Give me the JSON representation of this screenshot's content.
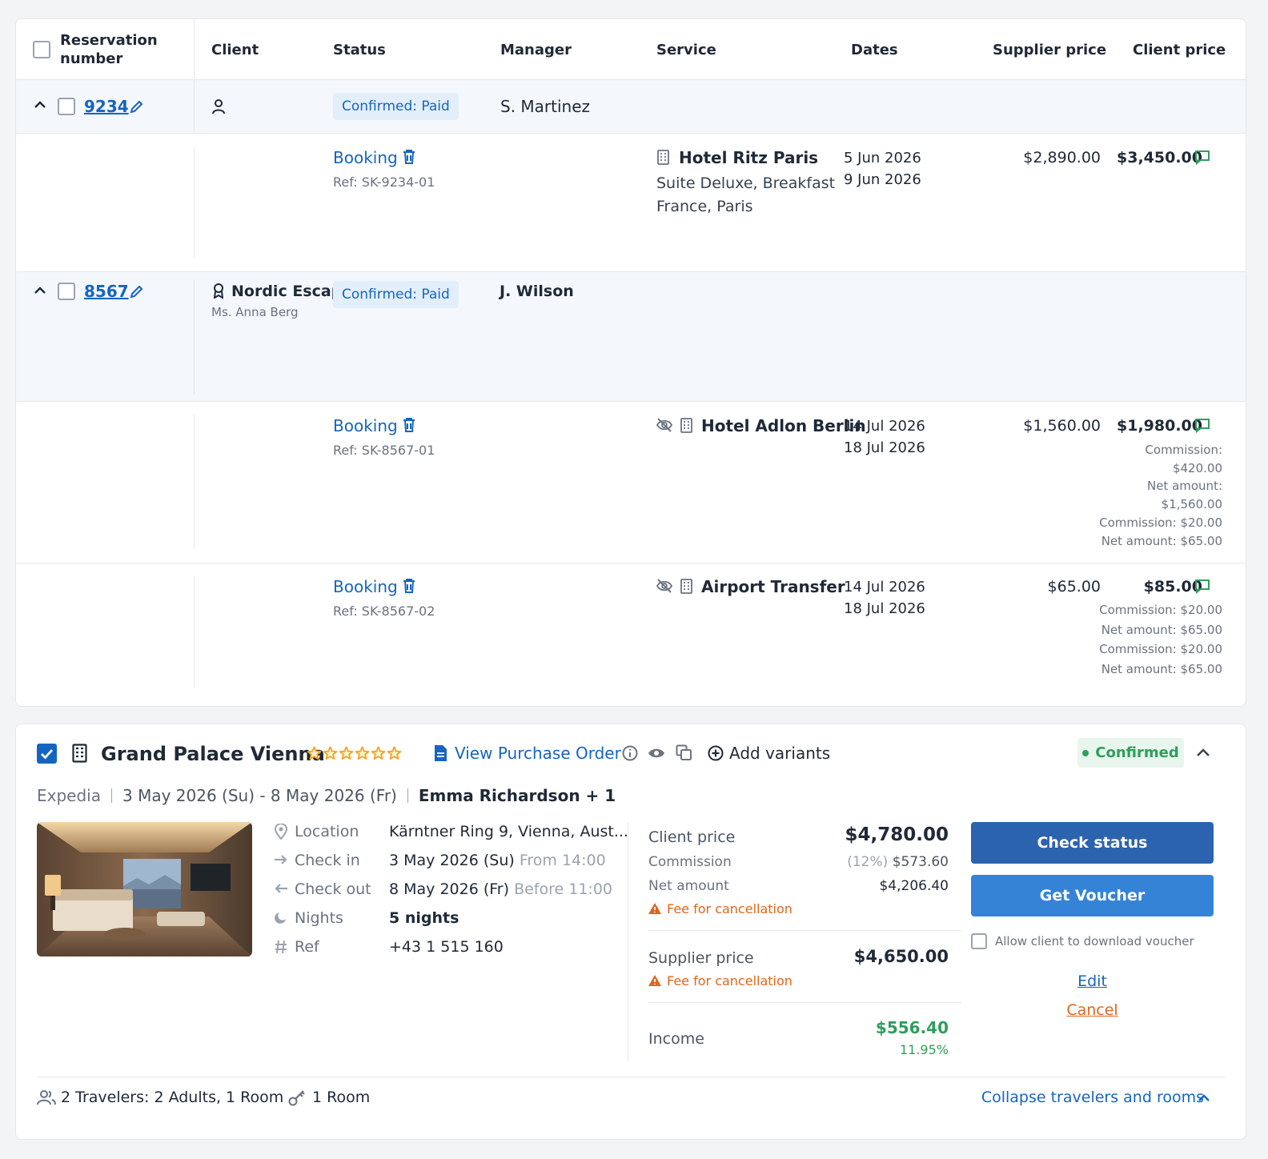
{
  "table": {
    "headers": {
      "reservation_line1": "Reservation",
      "reservation_line2": "number",
      "client": "Client",
      "status": "Status",
      "manager": "Manager",
      "service": "Service",
      "dates": "Dates",
      "supplier_price": "Supplier price",
      "client_price": "Client price"
    },
    "reservations": [
      {
        "number": "9234",
        "status": "Confirmed: Paid",
        "manager": "S. Martinez",
        "services": [
          {
            "label": "Booking",
            "ref": "Ref: SK-9234-01",
            "name": "Hotel Ritz Paris",
            "sub1": "Suite Deluxe, Breakfast",
            "sub2": "France, Paris",
            "date_from": "5 Jun 2026",
            "date_to": "9 Jun 2026",
            "supplier_price": "$2,890.00",
            "client_price": "$3,450.00"
          }
        ]
      },
      {
        "number": "8567",
        "client_name": "Nordic Escape",
        "client_contact": "Ms. Anna Berg",
        "status": "Confirmed: Paid",
        "manager": "J. Wilson",
        "services": [
          {
            "label": "Booking",
            "ref": "Ref: SK-8567-01",
            "name": "Hotel Adlon Berlin",
            "date_from": "14 Jul 2026",
            "date_to": "18 Jul 2026",
            "supplier_price": "$1,560.00",
            "client_price": "$1,980.00",
            "notes": [
              "Commission:",
              "$420.00",
              "Net amount:",
              "$1,560.00",
              "Commission: $20.00",
              "Net amount: $65.00"
            ]
          },
          {
            "label": "Booking",
            "ref": "Ref: SK-8567-02",
            "name": "Airport Transfer",
            "date_from": "14 Jul 2026",
            "date_to": "18 Jul 2026",
            "supplier_price": "$65.00",
            "client_price": "$85.00",
            "notes": [
              "Commission: $20.00",
              "Net amount: $65.00",
              "Commission: $20.00",
              "Net amount: $65.00"
            ]
          }
        ]
      }
    ]
  },
  "detail": {
    "hotel_name": "Grand Palace Vienna",
    "stars": 6,
    "view_po": "View Purchase Order",
    "add_variants": "Add variants",
    "status": "Confirmed",
    "provider": "Expedia",
    "date_range": "3 May 2026 (Su) - 8 May 2026 (Fr)",
    "guest": "Emma Richardson + 1",
    "info": {
      "location_label": "Location",
      "location_value": "Kärntner Ring 9, Vienna, Aust...",
      "checkin_label": "Check in",
      "checkin_value": "3 May 2026 (Su)",
      "checkin_time": "From 14:00",
      "checkout_label": "Check out",
      "checkout_value": "8 May 2026 (Fr)",
      "checkout_time": "Before 11:00",
      "nights_label": "Nights",
      "nights_value": "5 nights",
      "ref_label": "Ref",
      "ref_value": "+43 1 515 160"
    },
    "pricing": {
      "client_price_label": "Client price",
      "client_price": "$4,780.00",
      "commission_label": "Commission",
      "commission_pct": "(12%)",
      "commission_value": "$573.60",
      "net_label": "Net amount",
      "net_value": "$4,206.40",
      "fee_label": "Fee for cancellation",
      "supplier_price_label": "Supplier price",
      "supplier_price": "$4,650.00",
      "supplier_fee_label": "Fee for cancellation",
      "income_label": "Income",
      "income_value": "$556.40",
      "income_pct": "11.95%"
    },
    "actions": {
      "check_status": "Check status",
      "get_voucher": "Get Voucher",
      "allow_download": "Allow client to download voucher",
      "edit": "Edit",
      "cancel": "Cancel"
    },
    "footer": {
      "travelers": "2 Travelers: 2 Adults, 1 Room",
      "rooms": "1 Room",
      "collapse": "Collapse travelers and rooms"
    }
  },
  "colors": {
    "accent": "#1565c0",
    "button_dark": "#2b63ae",
    "button": "#3583d6",
    "success": "#2e9e5b",
    "warning": "#e0661a"
  }
}
